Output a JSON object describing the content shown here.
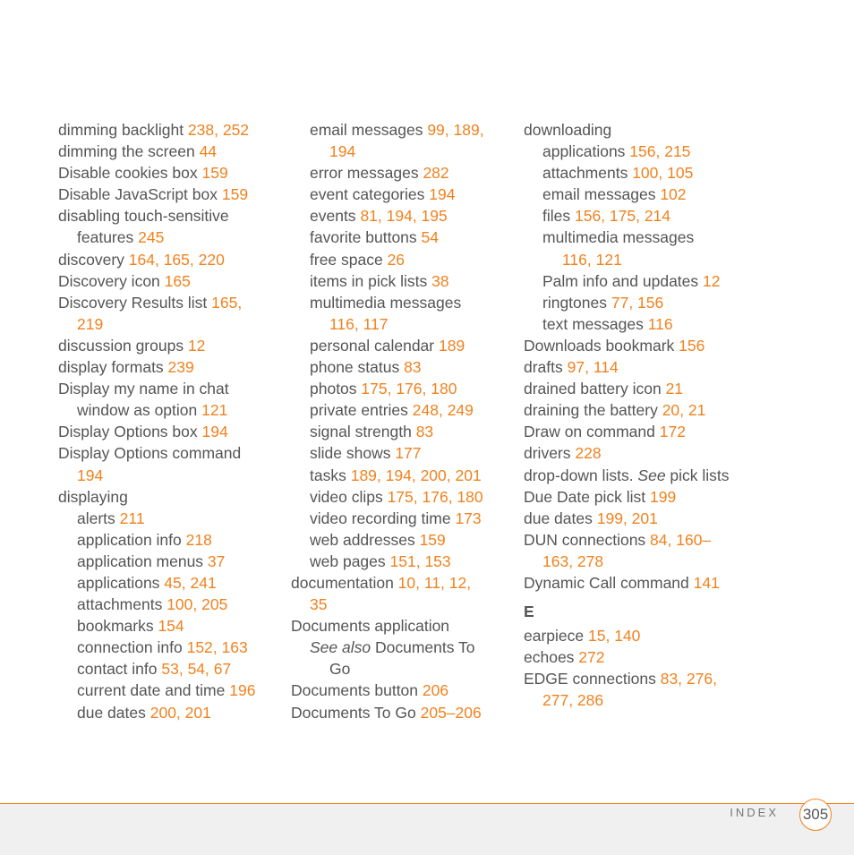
{
  "columns": [
    {
      "entries": [
        {
          "level": 0,
          "text": "dimming backlight ",
          "pages": "238, 252"
        },
        {
          "level": 0,
          "text": "dimming the screen ",
          "pages": "44"
        },
        {
          "level": 0,
          "text": "Disable cookies box ",
          "pages": "159"
        },
        {
          "level": 0,
          "text": "Disable JavaScript box ",
          "pages": "159"
        },
        {
          "level": 0,
          "text": "disabling touch-sensitive",
          "pages": ""
        },
        {
          "level": 1,
          "text": "features ",
          "pages": "245"
        },
        {
          "level": 0,
          "text": "discovery ",
          "pages": "164, 165, 220"
        },
        {
          "level": 0,
          "text": "Discovery icon ",
          "pages": "165"
        },
        {
          "level": 0,
          "text": "Discovery Results list ",
          "pages": "165,"
        },
        {
          "level": 1,
          "text": "",
          "pages": "219"
        },
        {
          "level": 0,
          "text": "discussion groups ",
          "pages": "12"
        },
        {
          "level": 0,
          "text": "display formats ",
          "pages": "239"
        },
        {
          "level": 0,
          "text": "Display my name in chat",
          "pages": ""
        },
        {
          "level": 1,
          "text": "window as option ",
          "pages": "121"
        },
        {
          "level": 0,
          "text": "Display Options box ",
          "pages": "194"
        },
        {
          "level": 0,
          "text": "Display Options command",
          "pages": ""
        },
        {
          "level": 1,
          "text": "",
          "pages": "194"
        },
        {
          "level": 0,
          "text": "displaying",
          "pages": ""
        },
        {
          "level": 1,
          "text": "alerts ",
          "pages": "211"
        },
        {
          "level": 1,
          "text": "application info ",
          "pages": "218"
        },
        {
          "level": 1,
          "text": "application menus ",
          "pages": "37"
        },
        {
          "level": 1,
          "text": "applications ",
          "pages": "45, 241"
        },
        {
          "level": 1,
          "text": "attachments ",
          "pages": "100, 205"
        },
        {
          "level": 1,
          "text": "bookmarks ",
          "pages": "154"
        },
        {
          "level": 1,
          "text": "connection info ",
          "pages": "152, 163"
        },
        {
          "level": 1,
          "text": "contact info ",
          "pages": "53, 54, 67"
        },
        {
          "level": 1,
          "text": "current date and time ",
          "pages": "196"
        },
        {
          "level": 1,
          "text": "due dates ",
          "pages": "200, 201"
        }
      ]
    },
    {
      "entries": [
        {
          "level": 1,
          "text": "email messages ",
          "pages": "99, 189,"
        },
        {
          "level": 2,
          "text": "",
          "pages": "194"
        },
        {
          "level": 1,
          "text": "error messages ",
          "pages": "282"
        },
        {
          "level": 1,
          "text": "event categories ",
          "pages": "194"
        },
        {
          "level": 1,
          "text": "events ",
          "pages": "81, 194, 195"
        },
        {
          "level": 1,
          "text": "favorite buttons ",
          "pages": "54"
        },
        {
          "level": 1,
          "text": "free space ",
          "pages": "26"
        },
        {
          "level": 1,
          "text": "items in pick lists ",
          "pages": "38"
        },
        {
          "level": 1,
          "text": "multimedia messages",
          "pages": ""
        },
        {
          "level": 2,
          "text": "",
          "pages": "116, 117"
        },
        {
          "level": 1,
          "text": "personal calendar ",
          "pages": "189"
        },
        {
          "level": 1,
          "text": "phone status ",
          "pages": "83"
        },
        {
          "level": 1,
          "text": "photos ",
          "pages": "175, 176, 180"
        },
        {
          "level": 1,
          "text": "private entries ",
          "pages": "248, 249"
        },
        {
          "level": 1,
          "text": "signal strength ",
          "pages": "83"
        },
        {
          "level": 1,
          "text": "slide shows ",
          "pages": "177"
        },
        {
          "level": 1,
          "text": "tasks ",
          "pages": "189, 194, 200, 201"
        },
        {
          "level": 1,
          "text": "video clips ",
          "pages": "175, 176, 180"
        },
        {
          "level": 1,
          "text": "video recording time ",
          "pages": "173"
        },
        {
          "level": 1,
          "text": "web addresses ",
          "pages": "159"
        },
        {
          "level": 1,
          "text": "web pages ",
          "pages": "151, 153"
        },
        {
          "level": 0,
          "text": "documentation ",
          "pages": "10, 11, 12,"
        },
        {
          "level": 1,
          "text": "",
          "pages": "35"
        },
        {
          "level": 0,
          "text": "Documents application",
          "pages": ""
        },
        {
          "level": 1,
          "italic": "See also",
          "text": " Documents To",
          "pages": ""
        },
        {
          "level": 2,
          "text": "Go",
          "pages": ""
        },
        {
          "level": 0,
          "text": "Documents button ",
          "pages": "206"
        },
        {
          "level": 0,
          "text": "Documents To Go ",
          "pages": "205–206"
        }
      ]
    },
    {
      "entries": [
        {
          "level": 0,
          "text": "downloading",
          "pages": ""
        },
        {
          "level": 1,
          "text": "applications ",
          "pages": "156, 215"
        },
        {
          "level": 1,
          "text": "attachments ",
          "pages": "100, 105"
        },
        {
          "level": 1,
          "text": "email messages ",
          "pages": "102"
        },
        {
          "level": 1,
          "text": "files ",
          "pages": "156, 175, 214"
        },
        {
          "level": 1,
          "text": "multimedia messages",
          "pages": ""
        },
        {
          "level": 2,
          "text": "",
          "pages": "116, 121"
        },
        {
          "level": 1,
          "text": "Palm info and updates ",
          "pages": "12"
        },
        {
          "level": 1,
          "text": "ringtones ",
          "pages": "77, 156"
        },
        {
          "level": 1,
          "text": "text messages ",
          "pages": "116"
        },
        {
          "level": 0,
          "text": "Downloads bookmark ",
          "pages": "156"
        },
        {
          "level": 0,
          "text": "drafts ",
          "pages": "97, 114"
        },
        {
          "level": 0,
          "text": "drained battery icon ",
          "pages": "21"
        },
        {
          "level": 0,
          "text": "draining the battery ",
          "pages": "20, 21"
        },
        {
          "level": 0,
          "text": "Draw on command ",
          "pages": "172"
        },
        {
          "level": 0,
          "text": "drivers ",
          "pages": "228"
        },
        {
          "level": 0,
          "text": "drop-down lists. ",
          "italic_after": "See",
          "tail": " pick lists",
          "pages": ""
        },
        {
          "level": 0,
          "text": "Due Date pick list ",
          "pages": "199"
        },
        {
          "level": 0,
          "text": "due dates ",
          "pages": "199, 201"
        },
        {
          "level": 0,
          "text": "DUN connections ",
          "pages": "84, 160–"
        },
        {
          "level": 1,
          "text": "",
          "pages": "163, 278"
        },
        {
          "level": 0,
          "text": "Dynamic Call command ",
          "pages": "141"
        }
      ],
      "section_letter": "E",
      "section_entries": [
        {
          "level": 0,
          "text": "earpiece ",
          "pages": "15, 140"
        },
        {
          "level": 0,
          "text": "echoes ",
          "pages": "272"
        },
        {
          "level": 0,
          "text": "EDGE connections ",
          "pages": "83, 276,"
        },
        {
          "level": 1,
          "text": "",
          "pages": "277, 286"
        }
      ]
    }
  ],
  "footer": {
    "label": "INDEX",
    "page_number": "305"
  },
  "colors": {
    "accent": "#f0821e",
    "text": "#555555",
    "footer_bg": "#f0f0f0"
  }
}
